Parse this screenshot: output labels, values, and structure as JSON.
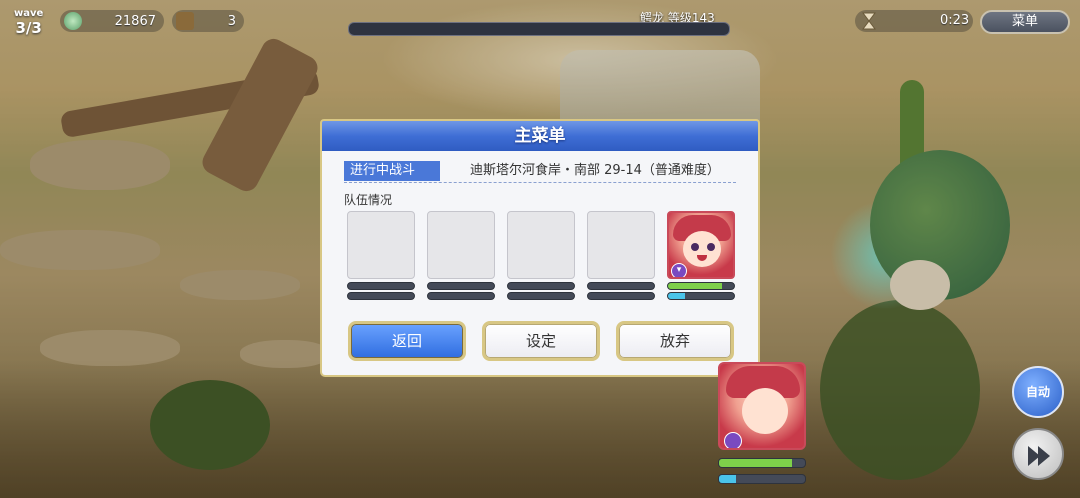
{
  "hud": {
    "wave_label": "wave",
    "wave_value": "3/3",
    "currency_value": "21867",
    "item_count": "3",
    "boss_label": "鳄龙 等级143",
    "timer": "0:23",
    "menu_button": "菜单"
  },
  "dialog": {
    "title": "主菜单",
    "battle_tag": "进行中战斗",
    "stage_name": "迪斯塔尔河食岸・南部 29-14（普通难度）",
    "team_label": "队伍情况",
    "slots": [
      {
        "filled": false
      },
      {
        "filled": false
      },
      {
        "filled": false
      },
      {
        "filled": false
      },
      {
        "filled": true,
        "hp_fraction": 0.82,
        "tp_fraction": 0.25
      }
    ],
    "buttons": {
      "back": "返回",
      "settings": "设定",
      "quit": "放弃"
    }
  },
  "bottom": {
    "auto_label": "自动",
    "char_hp_fraction": 0.85,
    "char_tp_fraction": 0.2
  },
  "colors": {
    "accent_blue": "#3f6ed5",
    "gold_border": "#d8c784",
    "hp_green": "#7ed04a",
    "tp_cyan": "#4ac4ea"
  }
}
